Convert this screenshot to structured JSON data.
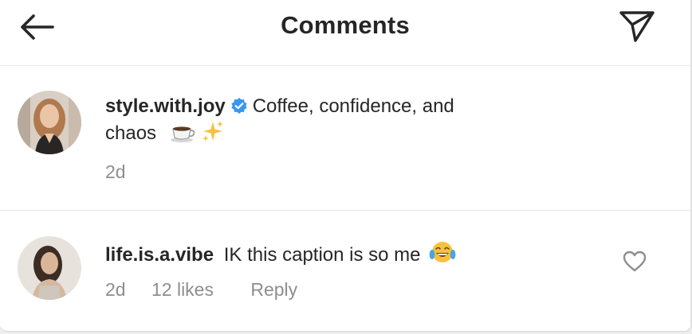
{
  "header": {
    "title": "Comments",
    "back_icon": "arrow-left-icon",
    "share_icon": "paper-plane-icon"
  },
  "caption": {
    "username": "style.with.joy",
    "verified": true,
    "text_line1": "Coffee, confidence, and",
    "text_line2": "chaos",
    "emojis": [
      "coffee-cup-icon",
      "sparkles-icon"
    ],
    "time": "2d"
  },
  "comments": [
    {
      "username": "life.is.a.vibe",
      "text": "IK this caption is so me",
      "emoji": "tears-of-joy-icon",
      "time": "2d",
      "likes": "12 likes",
      "reply_label": "Reply",
      "like_icon": "heart-outline-icon"
    }
  ],
  "colors": {
    "text": "#262626",
    "secondary": "#8e8e8e",
    "verified_blue": "#3897f0",
    "divider": "#e6e6e6"
  }
}
